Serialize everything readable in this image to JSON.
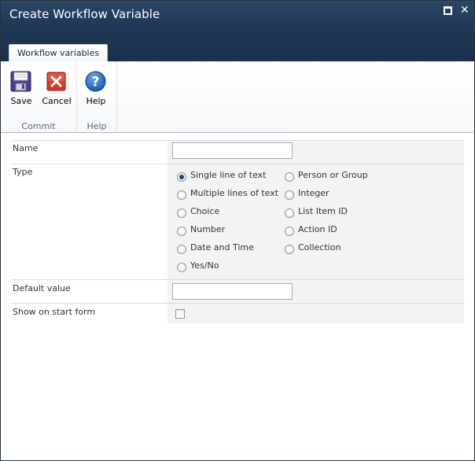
{
  "window": {
    "title": "Create Workflow Variable",
    "maximize_icon": "maximize-icon",
    "close_icon": "close-icon"
  },
  "ribbon": {
    "tab_label": "Workflow variables",
    "groups": [
      {
        "label": "Commit",
        "buttons": [
          {
            "label": "Save",
            "icon": "floppy-disk-icon"
          },
          {
            "label": "Cancel",
            "icon": "red-x-icon"
          }
        ]
      },
      {
        "label": "Help",
        "buttons": [
          {
            "label": "Help",
            "icon": "question-mark-icon"
          }
        ]
      }
    ]
  },
  "form": {
    "name": {
      "label": "Name",
      "value": ""
    },
    "type": {
      "label": "Type",
      "selected": "Single line of text",
      "options_left": [
        "Single line of text",
        "Multiple lines of text",
        "Choice",
        "Number",
        "Date and Time",
        "Yes/No"
      ],
      "options_right": [
        "Person or Group",
        "Integer",
        "List Item ID",
        "Action ID",
        "Collection"
      ]
    },
    "default_value": {
      "label": "Default value",
      "value": ""
    },
    "show_on_start_form": {
      "label": "Show on start form",
      "checked": false
    }
  },
  "colors": {
    "title_bar": "#223a58",
    "selected_radio": "#1f3f66",
    "field_background": "#f3f3f3"
  }
}
